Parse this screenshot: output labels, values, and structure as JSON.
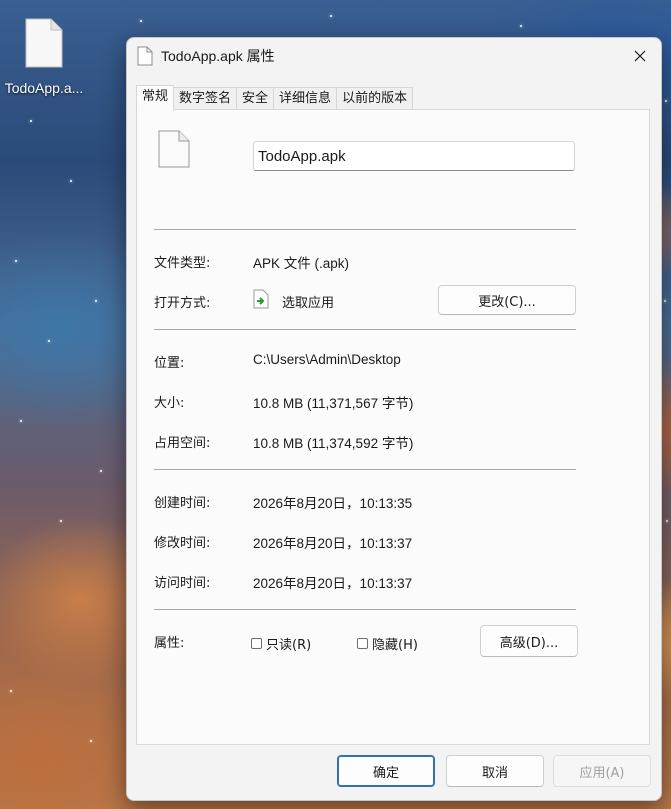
{
  "desktop": {
    "icon_label": "TodoApp.a..."
  },
  "dialog": {
    "title": "TodoApp.apk 属性",
    "tabs": [
      {
        "label": "常规",
        "active": true
      },
      {
        "label": "数字签名",
        "active": false
      },
      {
        "label": "安全",
        "active": false
      },
      {
        "label": "详细信息",
        "active": false
      },
      {
        "label": "以前的版本",
        "active": false
      }
    ],
    "filename_value": "TodoApp.apk",
    "file_type": {
      "label": "文件类型:",
      "value": "APK 文件 (.apk)"
    },
    "open_with": {
      "label": "打开方式:",
      "value": "选取应用",
      "button": "更改(C)..."
    },
    "location": {
      "label": "位置:",
      "value": "C:\\Users\\Admin\\Desktop"
    },
    "size": {
      "label": "大小:",
      "value": "10.8 MB (11,371,567 字节)"
    },
    "size_on_disk": {
      "label": "占用空间:",
      "value": "10.8 MB (11,374,592 字节)"
    },
    "created": {
      "label": "创建时间:",
      "value": "2026年8月20日，10:13:35"
    },
    "modified": {
      "label": "修改时间:",
      "value": "2026年8月20日，10:13:37"
    },
    "accessed": {
      "label": "访问时间:",
      "value": "2026年8月20日，10:13:37"
    },
    "attributes": {
      "label": "属性:",
      "readonly": {
        "label": "只读(R)",
        "checked": false
      },
      "hidden": {
        "label": "隐藏(H)",
        "checked": false
      },
      "advanced_button": "高级(D)..."
    },
    "footer": {
      "ok": "确定",
      "cancel": "取消",
      "apply": "应用(A)"
    }
  },
  "colors": {
    "dialog_bg": "#f3f3f3",
    "panel_bg": "#fbfbfb",
    "accent": "#2f6fb5"
  },
  "icons": [
    "file-icon",
    "close-icon",
    "open-app-icon"
  ]
}
